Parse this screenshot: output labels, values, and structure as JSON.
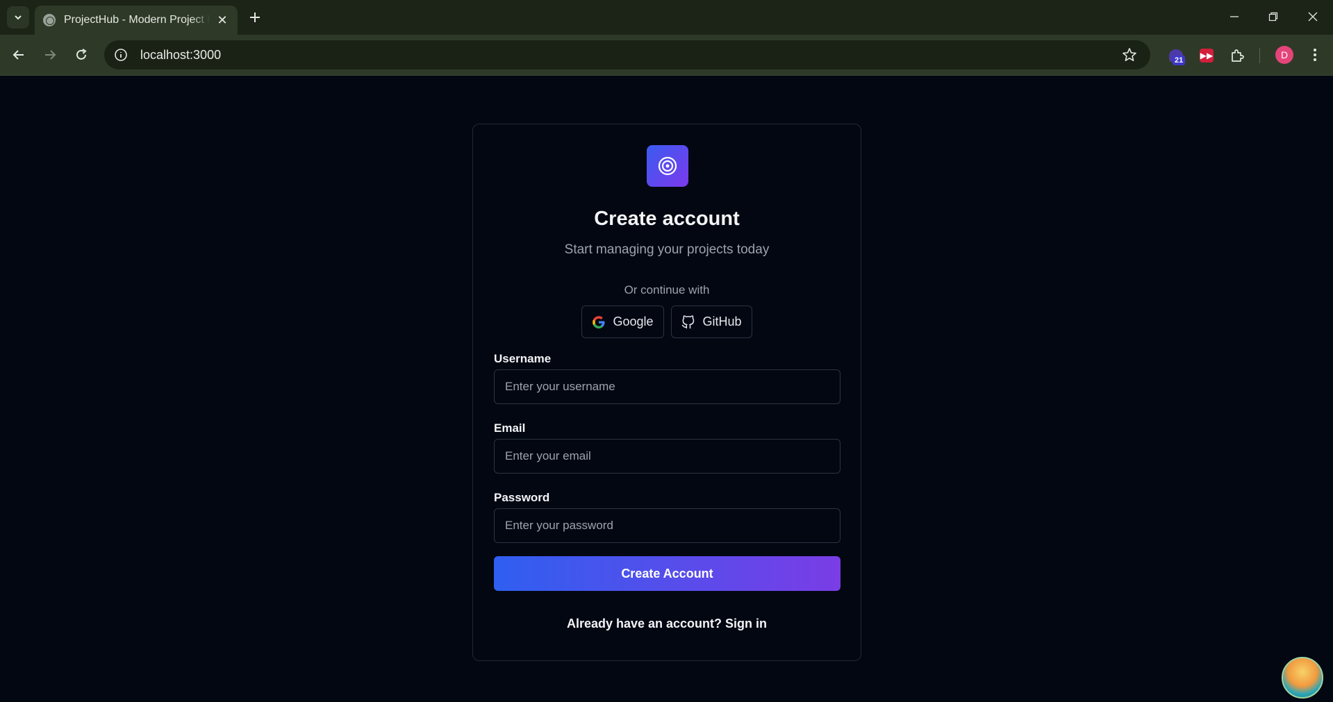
{
  "browser": {
    "tab_title": "ProjectHub - Modern Project Management",
    "url": "localhost:3000",
    "extension_badge": "21",
    "profile_initial": "D",
    "icons": {
      "tab_search": "chevron-down-icon",
      "favicon": "globe-icon",
      "tab_close": "close-icon",
      "new_tab": "plus-icon",
      "back": "arrow-left-icon",
      "forward": "arrow-right-icon",
      "reload": "reload-icon",
      "site_info": "info-icon",
      "bookmark": "star-icon",
      "extensions": "puzzle-icon",
      "menu": "more-vertical-icon"
    }
  },
  "auth": {
    "logo_icon": "target-icon",
    "title": "Create account",
    "subtitle": "Start managing your projects today",
    "divider_text": "Or continue with",
    "oauth": {
      "google": "Google",
      "github": "GitHub"
    },
    "fields": {
      "username": {
        "label": "Username",
        "placeholder": "Enter your username",
        "value": ""
      },
      "email": {
        "label": "Email",
        "placeholder": "Enter your email",
        "value": ""
      },
      "password": {
        "label": "Password",
        "placeholder": "Enter your password",
        "value": ""
      }
    },
    "submit_label": "Create Account",
    "signin_text": "Already have an account? Sign in"
  },
  "colors": {
    "page_bg": "#030712",
    "accent_start": "#2f5ff0",
    "accent_end": "#7a3de6",
    "avatar": "#e5447a"
  }
}
